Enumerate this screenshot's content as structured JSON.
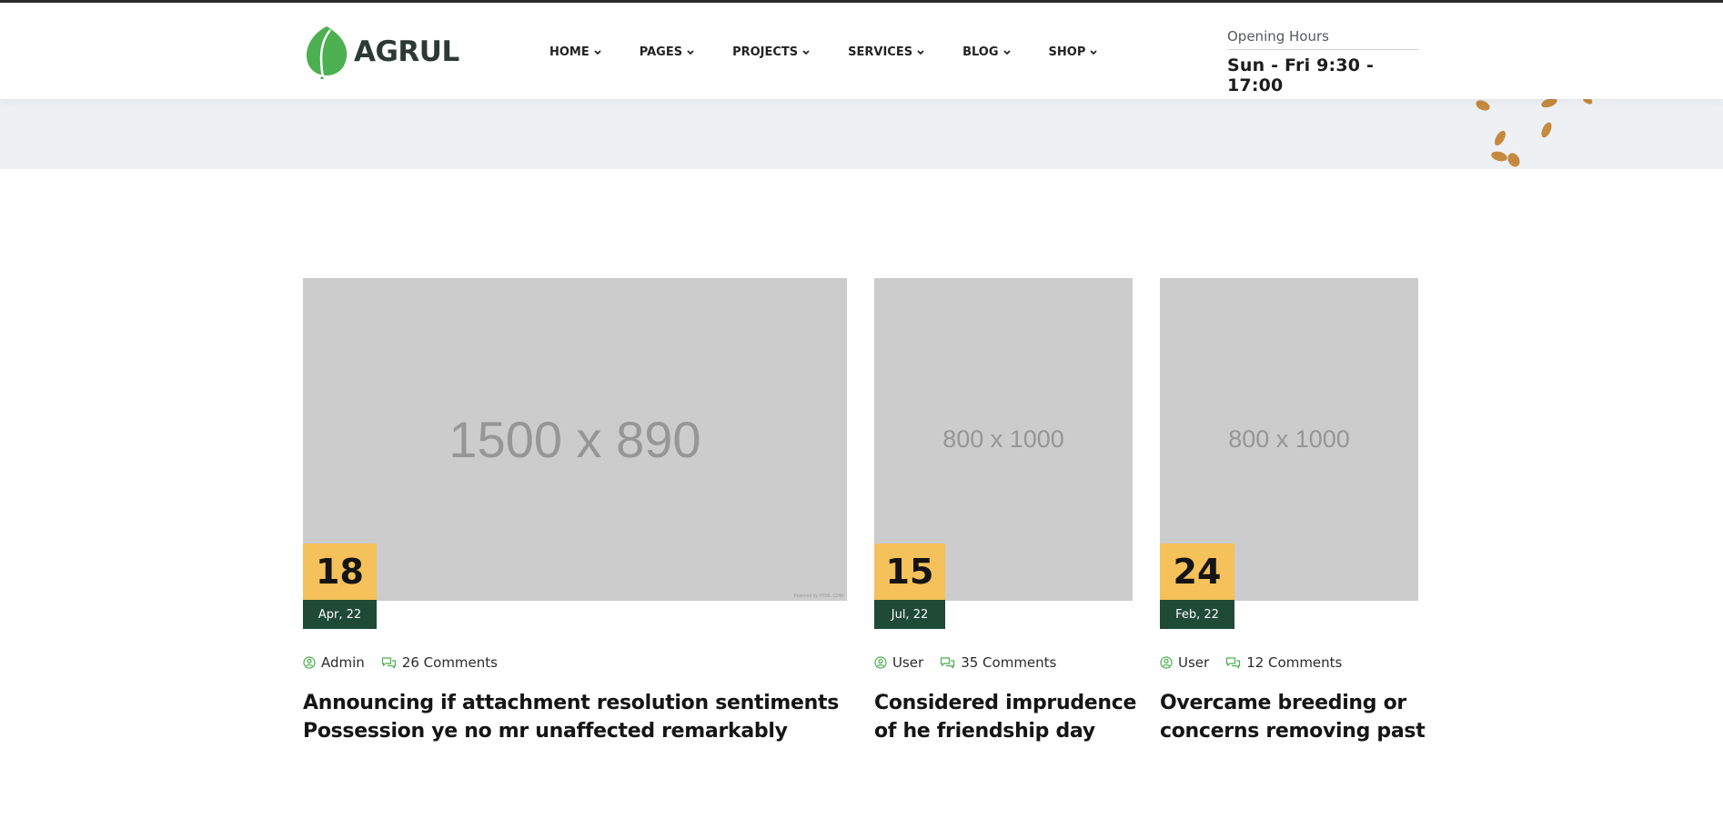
{
  "brand": {
    "name": "AGRUL",
    "leaf_color": "#4caf50"
  },
  "nav": {
    "items": [
      {
        "label": "HOME"
      },
      {
        "label": "PAGES"
      },
      {
        "label": "PROJECTS"
      },
      {
        "label": "SERVICES"
      },
      {
        "label": "BLOG"
      },
      {
        "label": "SHOP"
      }
    ]
  },
  "hours": {
    "label": "Opening Hours",
    "value": "Sun - Fri 9:30 - 17:00"
  },
  "colors": {
    "accent_yellow": "#f5c15a",
    "accent_green": "#1e4a36",
    "meta_icon": "#4caf50"
  },
  "posts": [
    {
      "image_label": "1500 x 890",
      "image_credit": "Powered by HTML.COM",
      "day": "18",
      "month": "Apr, 22",
      "author": "Admin",
      "comments": "26 Comments",
      "title_line1": "Announcing if attachment resolution sentiments",
      "title_line2": "Possession ye no mr unaffected remarkably"
    },
    {
      "image_label": "800 x 1000",
      "day": "15",
      "month": "Jul, 22",
      "author": "User",
      "comments": "35 Comments",
      "title_line1": "Considered imprudence",
      "title_line2": "of he friendship day"
    },
    {
      "image_label": "800 x 1000",
      "day": "24",
      "month": "Feb, 22",
      "author": "User",
      "comments": "12 Comments",
      "title_line1": "Overcame breeding or",
      "title_line2": "concerns removing past"
    }
  ]
}
